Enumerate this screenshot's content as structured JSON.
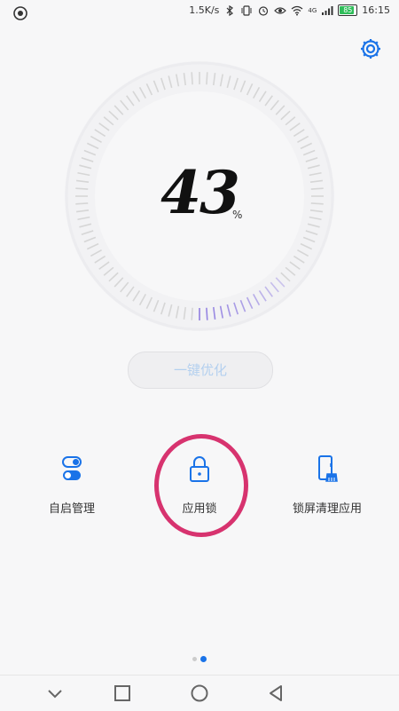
{
  "status_bar": {
    "net_speed": "1.5K/s",
    "signal_label": "4G",
    "battery_level": "85",
    "time": "16:15",
    "icons": [
      "app-notification-icon",
      "bluetooth-icon",
      "vibrate-icon",
      "alarm-icon",
      "eye-comfort-icon",
      "wifi-icon",
      "cellular-signal-icon",
      "battery-icon"
    ]
  },
  "header": {
    "settings_icon": "gear-icon"
  },
  "gauge": {
    "value": 43,
    "value_text": "43",
    "unit": "%"
  },
  "optimize_button": {
    "label": "一键优化"
  },
  "tools": [
    {
      "id": "startup",
      "label": "自启管理",
      "icon": "toggle-switch-icon"
    },
    {
      "id": "applock",
      "label": "应用锁",
      "icon": "lock-icon"
    },
    {
      "id": "lockscreen-clean",
      "label": "锁屏清理应用",
      "icon": "phone-broom-icon"
    }
  ],
  "pager": {
    "pages": 2,
    "current": 2
  },
  "nav_bar": {
    "buttons": [
      "down-chevron-icon",
      "recents-square-icon",
      "home-circle-icon",
      "back-triangle-icon"
    ]
  },
  "colors": {
    "accent": "#1a73e8",
    "highlight": "#d7336f",
    "gauge_active": "#8f7de0",
    "gauge_tick": "#d6d6d6"
  }
}
